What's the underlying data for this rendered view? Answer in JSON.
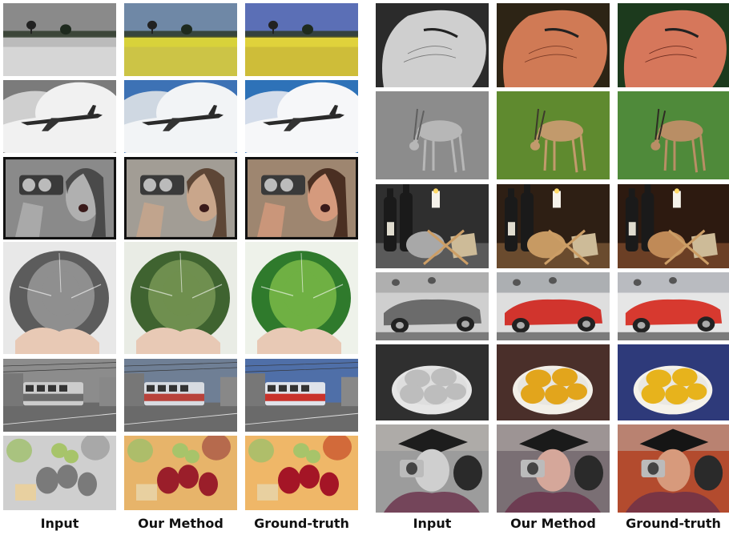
{
  "captions": [
    "Input",
    "Our Method",
    "Ground-truth",
    "Input",
    "Our Method",
    "Ground-truth"
  ],
  "rows_left": [
    {
      "scene": "yellow-flower-field"
    },
    {
      "scene": "airplane-over-clouds"
    },
    {
      "scene": "woman-with-camera"
    },
    {
      "scene": "cabbage-in-hands"
    },
    {
      "scene": "red-tram-street"
    },
    {
      "scene": "fruit-salad"
    }
  ],
  "rows_right": [
    {
      "scene": "caterpillar-on-finger"
    },
    {
      "scene": "gazelle-on-grass"
    },
    {
      "scene": "wine-bottles-candle"
    },
    {
      "scene": "red-convertible-car"
    },
    {
      "scene": "lemons-in-bowl"
    },
    {
      "scene": "graduate-with-camera"
    }
  ],
  "palettes": {
    "field": {
      "gray": [
        "#8a8a8a",
        "#bbbbbb",
        "#dddddd"
      ],
      "ours": [
        "#6f88a6",
        "#d8d23a",
        "#c9c14a"
      ],
      "gt": [
        "#5b6fb6",
        "#e0d23b",
        "#c9b83a"
      ]
    },
    "plane": {
      "gray": [
        "#7b7b7b",
        "#cfcfcf",
        "#f1f1f1"
      ],
      "ours": [
        "#3d72b5",
        "#cfd8e2",
        "#f2f4f6"
      ],
      "gt": [
        "#2e72b8",
        "#d3dcea",
        "#f6f7f9"
      ]
    },
    "woman": {
      "gray": [
        "#8a8a8a",
        "#b0b0b0",
        "#4a4a4a"
      ],
      "ours": [
        "#a29d95",
        "#c9a68b",
        "#5d4636"
      ],
      "gt": [
        "#9e8670",
        "#d59a7d",
        "#4a2f22"
      ]
    },
    "cabbage": {
      "gray": [
        "#e8e8e8",
        "#8f8f8f",
        "#5c5c5c"
      ],
      "ours": [
        "#e9ece5",
        "#6f8f4f",
        "#3f6330"
      ],
      "gt": [
        "#eef2ea",
        "#6fb043",
        "#2f7a2c"
      ]
    },
    "tram": {
      "gray": [
        "#8c8c8c",
        "#cccccc",
        "#6b6b6b"
      ],
      "ours": [
        "#6f7f95",
        "#d7dbe1",
        "#b8423b"
      ],
      "gt": [
        "#4f6fa8",
        "#dfe3ea",
        "#c9322b"
      ]
    },
    "fruit": {
      "gray": [
        "#a8a8a8",
        "#7a7a7a",
        "#cfcfcf"
      ],
      "ours": [
        "#b66a4d",
        "#9a1e2a",
        "#e7b46a"
      ],
      "gt": [
        "#d26a3a",
        "#a41526",
        "#efb768"
      ]
    },
    "finger": {
      "gray": [
        "#2b2b2b",
        "#cfcfcf",
        "#777777"
      ],
      "ours": [
        "#2d2415",
        "#d07a55",
        "#7a3a26"
      ],
      "gt": [
        "#1c3a1d",
        "#d6775b",
        "#6b2b1f"
      ]
    },
    "gazelle": {
      "gray": [
        "#8c8c8c",
        "#b7b7b7",
        "#5f5f5f"
      ],
      "ours": [
        "#5f8a2f",
        "#c29a6c",
        "#3d3a2c"
      ],
      "gt": [
        "#4f8a3a",
        "#b98e65",
        "#2e2b23"
      ]
    },
    "wine": {
      "gray": [
        "#5a5a5a",
        "#a8a8a8",
        "#2f2f2f"
      ],
      "ours": [
        "#6a4b2e",
        "#c79a63",
        "#2e1f14"
      ],
      "gt": [
        "#6b3f25",
        "#c08a57",
        "#2d1a10"
      ]
    },
    "car": {
      "gray": [
        "#9a9a9a",
        "#6b6b6b",
        "#cfcfcf"
      ],
      "ours": [
        "#8b8f95",
        "#d1342d",
        "#dedede"
      ],
      "gt": [
        "#9b9fa6",
        "#d7392f",
        "#e6e6e6"
      ]
    },
    "lemons": {
      "gray": [
        "#2f2f2f",
        "#bdbdbd",
        "#e5e5e5"
      ],
      "ours": [
        "#4a2f2a",
        "#e2a51c",
        "#f2efe8"
      ],
      "gt": [
        "#2e3a7a",
        "#e7b31c",
        "#f5f2ea"
      ]
    },
    "grad": {
      "gray": [
        "#9c9c9c",
        "#cfcfcf",
        "#1d1d1d"
      ],
      "ours": [
        "#7a6f74",
        "#d5a79a",
        "#1a1a1a"
      ],
      "gt": [
        "#b34b2e",
        "#d79a7c",
        "#151515"
      ]
    }
  }
}
